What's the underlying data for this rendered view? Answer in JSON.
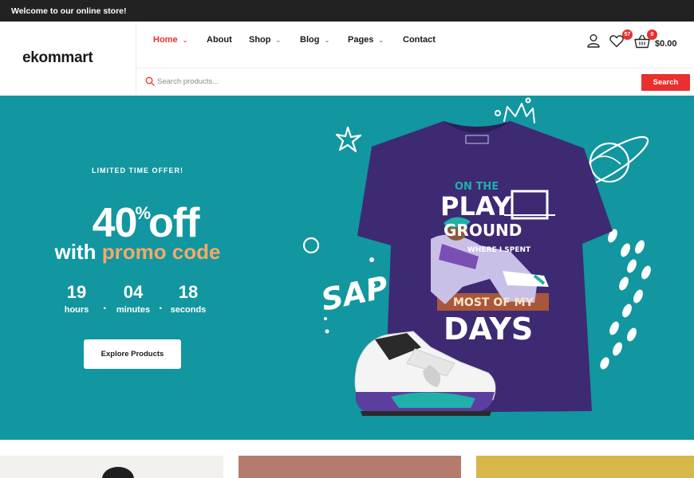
{
  "topbar": {
    "welcome": "Welcome to our online store!"
  },
  "header": {
    "logo": "ekommart",
    "nav": [
      {
        "label": "Home",
        "has_dropdown": true,
        "active": true
      },
      {
        "label": "About",
        "has_dropdown": false,
        "active": false
      },
      {
        "label": "Shop",
        "has_dropdown": true,
        "active": false
      },
      {
        "label": "Blog",
        "has_dropdown": true,
        "active": false
      },
      {
        "label": "Pages",
        "has_dropdown": true,
        "active": false
      },
      {
        "label": "Contact",
        "has_dropdown": false,
        "active": false
      }
    ],
    "wishlist_count": "57",
    "cart_count": "0",
    "cart_total": "$0.00",
    "search": {
      "placeholder": "Search products...",
      "value": "",
      "button_label": "Search"
    },
    "icons": {
      "account": "user-icon",
      "wishlist": "heart-icon",
      "cart": "basket-icon",
      "search": "search-icon"
    }
  },
  "hero": {
    "offer_tag": "LIMITED TIME OFFER!",
    "discount_value": "40",
    "discount_symbol": "%",
    "discount_suffix": "off",
    "promo_prefix": "with ",
    "promo_highlight": "promo code",
    "countdown": [
      {
        "value": "19",
        "label": "hours"
      },
      {
        "value": "04",
        "label": "minutes"
      },
      {
        "value": "18",
        "label": "seconds"
      }
    ],
    "cta_label": "Explore Products",
    "shirt_text": {
      "line1": "ON THE",
      "line2": "PLAY",
      "line3": "GROUND",
      "line4": "WHERE I SPENT",
      "line5": "MOST OF MY",
      "line6": "DAYS"
    },
    "doodle_text": "SAP",
    "colors": {
      "background": "#12969f",
      "accent": "#f5a86a",
      "shirt": "#3d2a73"
    }
  },
  "theme": {
    "brand_red": "#e8302f",
    "topbar_bg": "#222222"
  }
}
